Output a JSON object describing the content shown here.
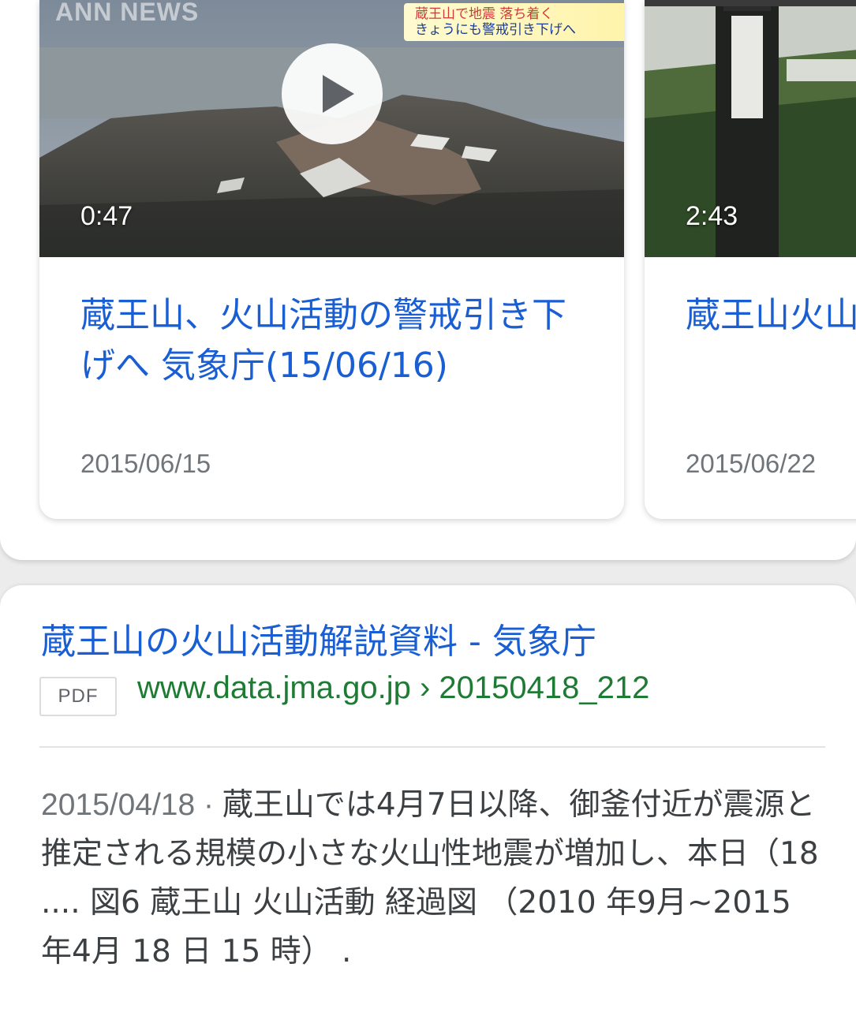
{
  "video_cards": [
    {
      "duration": "0:47",
      "title": "蔵王山、火山活動の警戒引き下げへ 気象庁(15/06/16)",
      "date": "2015/06/15",
      "thumbnail_logo": "ANN NEWS",
      "thumbnail_caption_line1": "蔵王山で地震 落ち着く",
      "thumbnail_caption_line2": "きょうにも警戒引き下げへ"
    },
    {
      "duration": "2:43",
      "title": "蔵王山火山の刈田リフ",
      "date": "2015/06/22"
    }
  ],
  "search_result": {
    "title": "蔵王山の火山活動解説資料 - 気象庁",
    "badge": "PDF",
    "url": "www.data.jma.go.jp › 20150418_212",
    "snippet_date": "2015/04/18",
    "snippet_separator": " · ",
    "snippet_text": "蔵王山では4月7日以降、御釜付近が震源と推定される規模の小さな火山性地震が増加し、本日（18 .... 図6 蔵王山 火山活動 経過図 （2010 年9月~2015 年4月 18 日 15 時） ."
  },
  "colors": {
    "link_blue": "#1a5ed3",
    "url_green": "#1e7b34",
    "meta_gray": "#70757a"
  },
  "icons": [
    "play-icon"
  ]
}
